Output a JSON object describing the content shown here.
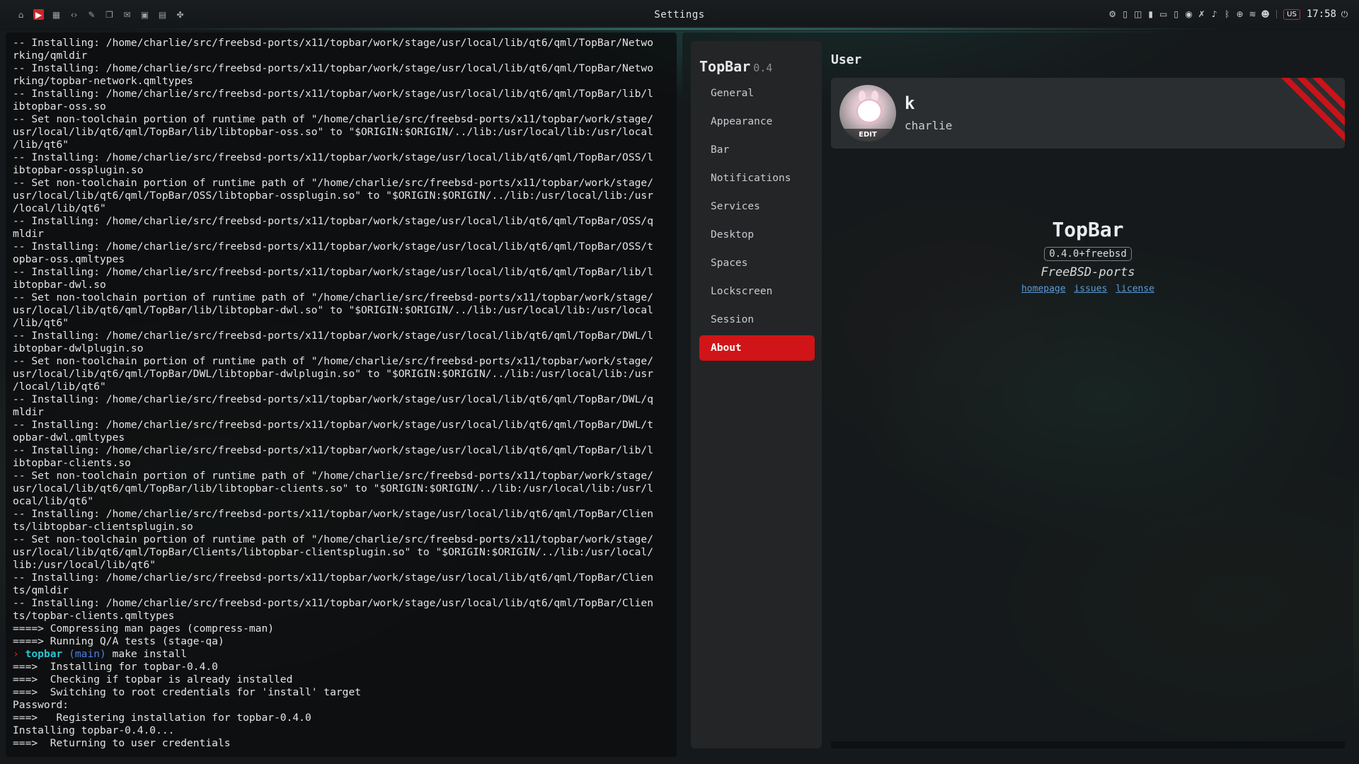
{
  "topbar": {
    "title": "Settings",
    "left_icons": [
      {
        "name": "home-icon",
        "glyph": "⌂"
      },
      {
        "name": "terminal-icon",
        "glyph": "▶",
        "active": true
      },
      {
        "name": "calendar-icon",
        "glyph": "▦"
      },
      {
        "name": "code-icon",
        "glyph": "‹›"
      },
      {
        "name": "editor-icon",
        "glyph": "✎"
      },
      {
        "name": "files-icon",
        "glyph": "❐"
      },
      {
        "name": "mail-icon",
        "glyph": "✉"
      },
      {
        "name": "package-icon",
        "glyph": "▣"
      },
      {
        "name": "spreadsheet-icon",
        "glyph": "▤"
      },
      {
        "name": "apps-icon",
        "glyph": "✤"
      }
    ],
    "tray_icons": [
      {
        "name": "settings-icon",
        "glyph": "⚙"
      },
      {
        "name": "battery-icon",
        "glyph": "▯"
      },
      {
        "name": "display-icon",
        "glyph": "◫"
      },
      {
        "name": "storage-icon",
        "glyph": "▮"
      },
      {
        "name": "layout-icon",
        "glyph": "▭"
      },
      {
        "name": "device-icon",
        "glyph": "▯"
      },
      {
        "name": "mic-icon",
        "glyph": "◉"
      },
      {
        "name": "mic-mute-icon",
        "glyph": "✗"
      },
      {
        "name": "volume-icon",
        "glyph": "♪"
      },
      {
        "name": "bluetooth-icon",
        "glyph": "ᛒ"
      },
      {
        "name": "network-icon",
        "glyph": "⊕"
      },
      {
        "name": "wifi-icon",
        "glyph": "≋"
      },
      {
        "name": "daemon-icon",
        "glyph": "☻"
      }
    ],
    "keyboard_layout": "US",
    "clock": "17:58",
    "power_icon": "⏻"
  },
  "terminal": {
    "lines": [
      "-- Installing: /home/charlie/src/freebsd-ports/x11/topbar/work/stage/usr/local/lib/qt6/qml/TopBar/Netwo",
      "rking/qmldir",
      "-- Installing: /home/charlie/src/freebsd-ports/x11/topbar/work/stage/usr/local/lib/qt6/qml/TopBar/Netwo",
      "rking/topbar-network.qmltypes",
      "-- Installing: /home/charlie/src/freebsd-ports/x11/topbar/work/stage/usr/local/lib/qt6/qml/TopBar/lib/l",
      "ibtopbar-oss.so",
      "-- Set non-toolchain portion of runtime path of \"/home/charlie/src/freebsd-ports/x11/topbar/work/stage/",
      "usr/local/lib/qt6/qml/TopBar/lib/libtopbar-oss.so\" to \"$ORIGIN:$ORIGIN/../lib:/usr/local/lib:/usr/local",
      "/lib/qt6\"",
      "-- Installing: /home/charlie/src/freebsd-ports/x11/topbar/work/stage/usr/local/lib/qt6/qml/TopBar/OSS/l",
      "ibtopbar-ossplugin.so",
      "-- Set non-toolchain portion of runtime path of \"/home/charlie/src/freebsd-ports/x11/topbar/work/stage/",
      "usr/local/lib/qt6/qml/TopBar/OSS/libtopbar-ossplugin.so\" to \"$ORIGIN:$ORIGIN/../lib:/usr/local/lib:/usr",
      "/local/lib/qt6\"",
      "-- Installing: /home/charlie/src/freebsd-ports/x11/topbar/work/stage/usr/local/lib/qt6/qml/TopBar/OSS/q",
      "mldir",
      "-- Installing: /home/charlie/src/freebsd-ports/x11/topbar/work/stage/usr/local/lib/qt6/qml/TopBar/OSS/t",
      "opbar-oss.qmltypes",
      "-- Installing: /home/charlie/src/freebsd-ports/x11/topbar/work/stage/usr/local/lib/qt6/qml/TopBar/lib/l",
      "ibtopbar-dwl.so",
      "-- Set non-toolchain portion of runtime path of \"/home/charlie/src/freebsd-ports/x11/topbar/work/stage/",
      "usr/local/lib/qt6/qml/TopBar/lib/libtopbar-dwl.so\" to \"$ORIGIN:$ORIGIN/../lib:/usr/local/lib:/usr/local",
      "/lib/qt6\"",
      "-- Installing: /home/charlie/src/freebsd-ports/x11/topbar/work/stage/usr/local/lib/qt6/qml/TopBar/DWL/l",
      "ibtopbar-dwlplugin.so",
      "-- Set non-toolchain portion of runtime path of \"/home/charlie/src/freebsd-ports/x11/topbar/work/stage/",
      "usr/local/lib/qt6/qml/TopBar/DWL/libtopbar-dwlplugin.so\" to \"$ORIGIN:$ORIGIN/../lib:/usr/local/lib:/usr",
      "/local/lib/qt6\"",
      "-- Installing: /home/charlie/src/freebsd-ports/x11/topbar/work/stage/usr/local/lib/qt6/qml/TopBar/DWL/q",
      "mldir",
      "-- Installing: /home/charlie/src/freebsd-ports/x11/topbar/work/stage/usr/local/lib/qt6/qml/TopBar/DWL/t",
      "opbar-dwl.qmltypes",
      "-- Installing: /home/charlie/src/freebsd-ports/x11/topbar/work/stage/usr/local/lib/qt6/qml/TopBar/lib/l",
      "ibtopbar-clients.so",
      "-- Set non-toolchain portion of runtime path of \"/home/charlie/src/freebsd-ports/x11/topbar/work/stage/",
      "usr/local/lib/qt6/qml/TopBar/lib/libtopbar-clients.so\" to \"$ORIGIN:$ORIGIN/../lib:/usr/local/lib:/usr/l",
      "ocal/lib/qt6\"",
      "-- Installing: /home/charlie/src/freebsd-ports/x11/topbar/work/stage/usr/local/lib/qt6/qml/TopBar/Clien",
      "ts/libtopbar-clientsplugin.so",
      "-- Set non-toolchain portion of runtime path of \"/home/charlie/src/freebsd-ports/x11/topbar/work/stage/",
      "usr/local/lib/qt6/qml/TopBar/Clients/libtopbar-clientsplugin.so\" to \"$ORIGIN:$ORIGIN/../lib:/usr/local/",
      "lib:/usr/local/lib/qt6\"",
      "-- Installing: /home/charlie/src/freebsd-ports/x11/topbar/work/stage/usr/local/lib/qt6/qml/TopBar/Clien",
      "ts/qmldir",
      "-- Installing: /home/charlie/src/freebsd-ports/x11/topbar/work/stage/usr/local/lib/qt6/qml/TopBar/Clien",
      "ts/topbar-clients.qmltypes",
      "====> Compressing man pages (compress-man)",
      "====> Running Q/A tests (stage-qa)"
    ],
    "prompt": {
      "arrow": "›",
      "dir": "topbar",
      "branch": "(main)",
      "command": "make install"
    },
    "after_lines": [
      "===>  Installing for topbar-0.4.0",
      "===>  Checking if topbar is already installed",
      "===>  Switching to root credentials for 'install' target",
      "Password:",
      "===>   Registering installation for topbar-0.4.0",
      "Installing topbar-0.4.0...",
      "===>  Returning to user credentials"
    ]
  },
  "settings": {
    "app_name": "TopBar",
    "app_version": "0.4",
    "nav": [
      "General",
      "Appearance",
      "Bar",
      "Notifications",
      "Services",
      "Desktop",
      "Spaces",
      "Lockscreen",
      "Session",
      "About"
    ],
    "active_nav": "About",
    "section_title": "User",
    "user": {
      "display_name": "k",
      "username": "charlie",
      "edit_label": "EDIT"
    },
    "about": {
      "name": "TopBar",
      "version": "0.4.0+freebsd",
      "distribution": "FreeBSD-ports",
      "links": [
        "homepage",
        "issues",
        "license"
      ]
    }
  },
  "colors": {
    "accent": "#d11417",
    "prompt_dir": "#27c5d2",
    "prompt_branch": "#4b7fe0",
    "link": "#5b9bd8"
  }
}
